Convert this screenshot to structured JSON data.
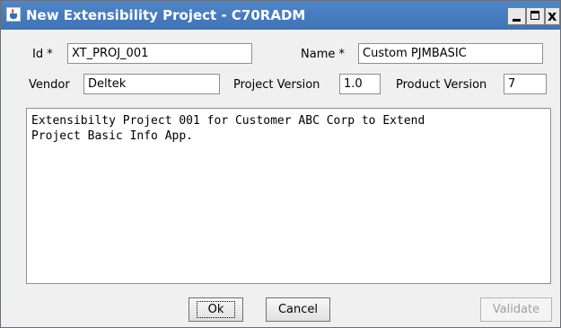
{
  "window": {
    "title": "New Extensibility Project - C70RADM",
    "buttons": {
      "minimize": "_",
      "maximize": "",
      "close": "x"
    }
  },
  "form": {
    "id_label": "Id *",
    "id_value": "XT_PROJ_001",
    "name_label": "Name *",
    "name_value": "Custom PJMBASIC",
    "vendor_label": "Vendor",
    "vendor_value": "Deltek",
    "project_version_label": "Project Version",
    "project_version_value": "1.0",
    "product_version_label": "Product Version",
    "product_version_value": "7",
    "description": "Extensibilty Project 001 for Customer ABC Corp to Extend\nProject Basic Info App."
  },
  "actions": {
    "ok_label": "Ok",
    "cancel_label": "Cancel",
    "validate_label": "Validate",
    "validate_enabled": false
  },
  "icons": {
    "app_icon": "java-app-icon",
    "minimize": "minimize-icon",
    "maximize": "maximize-icon",
    "close": "close-icon"
  },
  "colors": {
    "titlebar": "#4a7ec0",
    "window_bg": "#f0f0f0",
    "disabled_text": "#a0a0a0"
  }
}
